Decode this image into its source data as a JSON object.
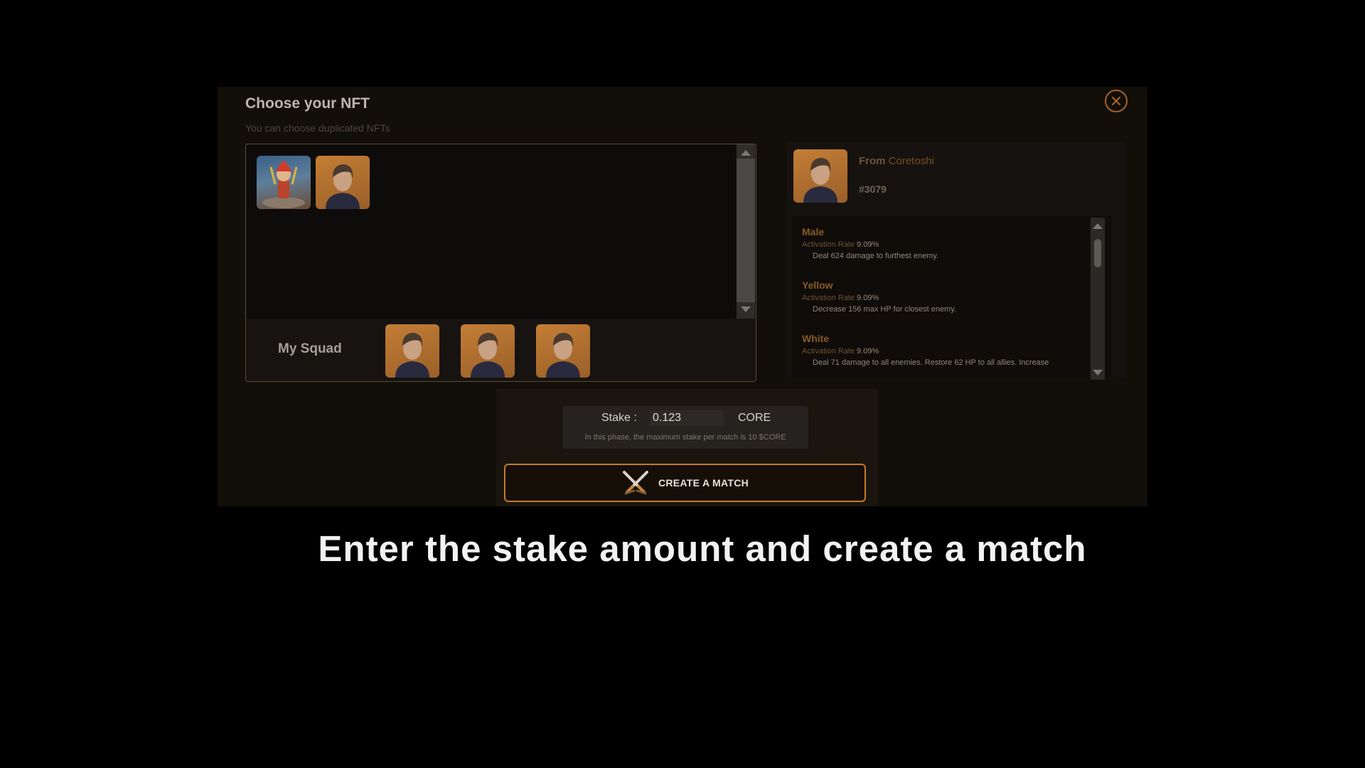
{
  "modal": {
    "title": "Choose your NFT",
    "subtitle": "You can choose duplicated NFTs",
    "close_icon": "close-icon"
  },
  "nft_list": {
    "items": [
      {
        "name": "hero-warrior"
      },
      {
        "name": "coretoshi"
      }
    ]
  },
  "squad": {
    "label": "My Squad",
    "slots": [
      "coretoshi",
      "coretoshi",
      "coretoshi"
    ]
  },
  "detail": {
    "from_label": "From",
    "owner": "Coretoshi",
    "token_id": "#3079",
    "skills": [
      {
        "name": "Male",
        "rate_label": "Activation Rate",
        "rate": "9.09%",
        "desc": "Deal 624 damage to furthest enemy."
      },
      {
        "name": "Yellow",
        "rate_label": "Activation Rate",
        "rate": "9.09%",
        "desc": "Decrease 156 max HP for closest enemy."
      },
      {
        "name": "White",
        "rate_label": "Activation Rate",
        "rate": "9.09%",
        "desc": "Deal 71 damage to all enemies. Restore 62 HP to all allies. Increase"
      }
    ]
  },
  "stake": {
    "label": "Stake :",
    "value": "0.123",
    "unit": "CORE",
    "note": "In this phase, the maximum stake per match is 10 $CORE"
  },
  "create_button": {
    "label": "CREATE A MATCH",
    "icon": "crossed-swords-icon"
  },
  "caption": "Enter the stake amount and create a match",
  "colors": {
    "accent": "#c77a2b",
    "panel": "#120e08",
    "background": "#000000"
  }
}
